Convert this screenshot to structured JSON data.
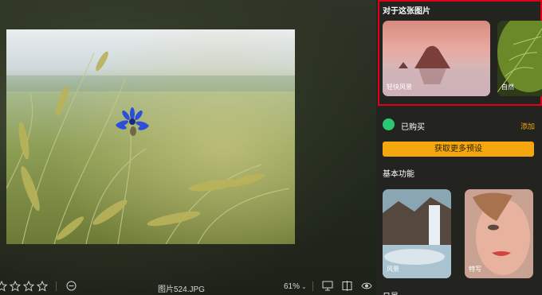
{
  "viewer": {
    "filename": "图片524.JPG",
    "zoom": "61%",
    "zoom_caret": "⌄",
    "rating": {
      "stars_total": 5,
      "stars_filled": 0
    },
    "icons": [
      "star-icon",
      "reject-icon",
      "compare-icon",
      "split-view-icon",
      "eye-icon"
    ]
  },
  "panel": {
    "about_title": "对于这张图片",
    "about_cards": [
      {
        "label": "轻快风景"
      },
      {
        "label": "自然"
      }
    ],
    "purchased_label": "已购买",
    "add_label": "添加",
    "more_presets_label": "获取更多预设",
    "basic_section_title": "基本功能",
    "basic_cards": [
      {
        "label": "风景"
      },
      {
        "label": "特写"
      }
    ],
    "next_section_title": "日景"
  },
  "colors": {
    "accent": "#f5a70f",
    "highlight_border": "#e0001a",
    "purchased_icon": "#2bc774",
    "panel_bg": "#23231f"
  }
}
